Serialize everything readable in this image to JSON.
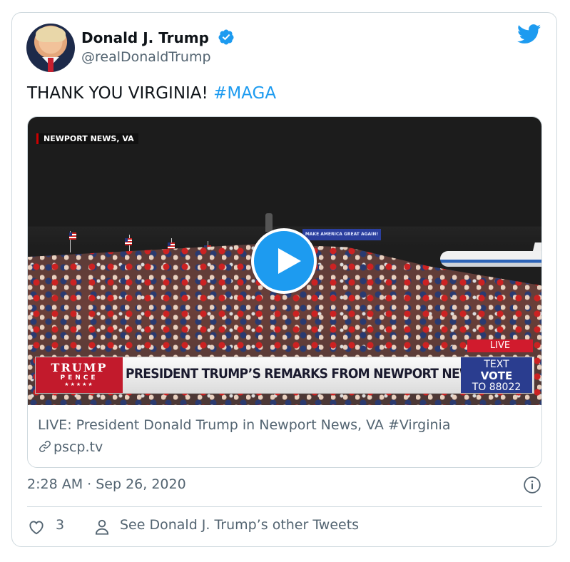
{
  "colors": {
    "accent": "#1d9bf0",
    "text_primary": "#0f1419",
    "text_secondary": "#536471",
    "border": "#cfd9de"
  },
  "author": {
    "display_name": "Donald J. Trump",
    "handle": "@realDonaldTrump",
    "verified_icon": "verified-badge-icon",
    "avatar_icon": "avatar"
  },
  "tweet": {
    "text": "THANK YOU VIRGINIA! ",
    "hashtag": "#MAGA"
  },
  "media": {
    "location_tag": "NEWPORT NEWS, VA",
    "stage_banner": "MAKE AMERICA GREAT AGAIN!",
    "chyron_logo_line1": "TRUMP",
    "chyron_logo_line2": "PENCE",
    "chyron_logo_stars": "★★★★★",
    "chyron_headline": "PRESIDENT TRUMP’S REMARKS FROM NEWPORT NEWS, VA",
    "live_label": "LIVE",
    "vote_line1": "TEXT",
    "vote_line2": "VOTE",
    "vote_line3": "TO 88022",
    "play_icon": "play-icon"
  },
  "link_card": {
    "title": "LIVE: President Donald Trump in Newport News, VA #Virginia",
    "domain": "pscp.tv"
  },
  "meta": {
    "timestamp": "2:28 AM · Sep 26, 2020"
  },
  "actions": {
    "like_count": "3",
    "see_other": "See Donald J. Trump’s other Tweets"
  }
}
